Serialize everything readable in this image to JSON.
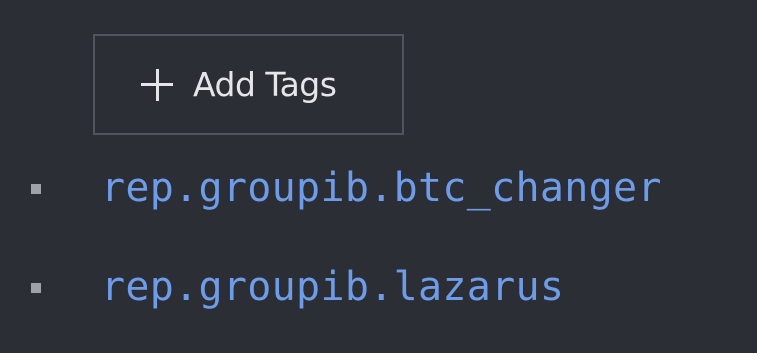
{
  "add_tags_button": {
    "icon": "plus-icon",
    "label": "Add Tags"
  },
  "tags": [
    {
      "label": "rep.groupib.btc_changer"
    },
    {
      "label": "rep.groupib.lazarus"
    }
  ],
  "colors": {
    "background": "#2b2e35",
    "tag_link": "#6f9ce8",
    "button_border": "#50545c",
    "button_text": "#e4e6ea",
    "bullet": "#9fa3a9"
  }
}
